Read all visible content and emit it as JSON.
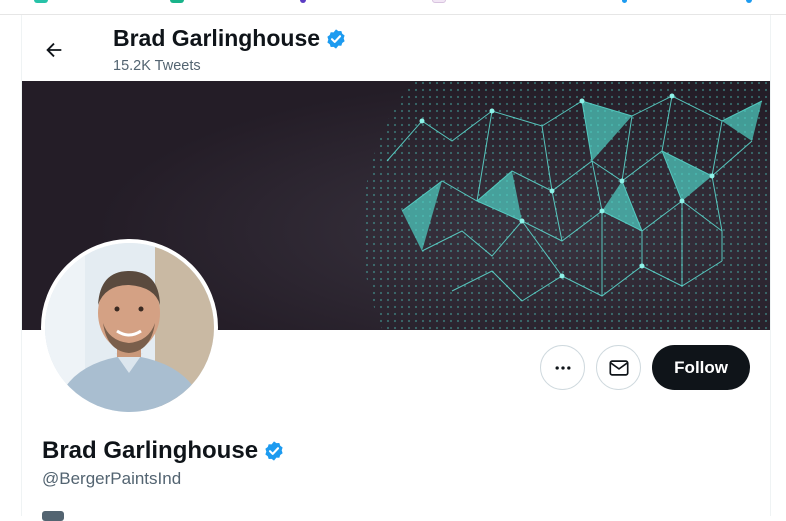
{
  "header": {
    "name": "Brad Garlinghouse",
    "tweet_count": "15.2K Tweets"
  },
  "profile": {
    "name": "Brad Garlinghouse",
    "handle": "@BergerPaintsInd",
    "verified": true
  },
  "actions": {
    "follow_label": "Follow",
    "more_icon": "more-horizontal-icon",
    "message_icon": "envelope-icon"
  },
  "colors": {
    "verified_blue": "#1d9bf0",
    "follow_bg": "#0f1419",
    "banner_bg": "#2a2230",
    "banner_network": "#4fd1c5",
    "muted_text": "#536471"
  }
}
